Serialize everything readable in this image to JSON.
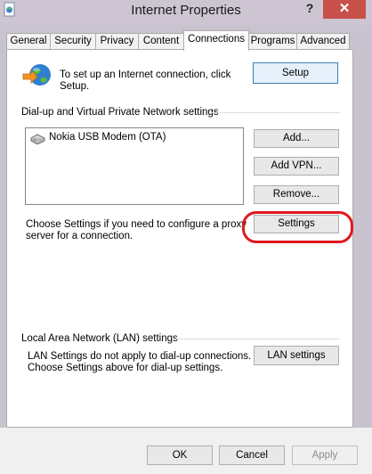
{
  "window": {
    "title": "Internet Properties",
    "help_label": "?",
    "close_label": "✕"
  },
  "tabs": [
    {
      "label": "General"
    },
    {
      "label": "Security"
    },
    {
      "label": "Privacy"
    },
    {
      "label": "Content"
    },
    {
      "label": "Connections"
    },
    {
      "label": "Programs"
    },
    {
      "label": "Advanced"
    }
  ],
  "active_tab": "Connections",
  "setup": {
    "description_line1": "To set up an Internet connection, click",
    "description_line2": "Setup.",
    "button_label": "Setup"
  },
  "dialup": {
    "section_title": "Dial-up and Virtual Private Network settings",
    "connections": [
      {
        "label": "Nokia  USB Modem (OTA)"
      }
    ],
    "add_label": "Add...",
    "add_vpn_label": "Add VPN...",
    "remove_label": "Remove...",
    "settings_hint_line1": "Choose Settings if you need to configure a proxy",
    "settings_hint_line2": "server for a connection.",
    "settings_label": "Settings"
  },
  "lan": {
    "section_title": "Local Area Network (LAN) settings",
    "hint_line1": "LAN Settings do not apply to dial-up connections.",
    "hint_line2": "Choose Settings above for dial-up settings.",
    "button_label": "LAN settings"
  },
  "footer": {
    "ok_label": "OK",
    "cancel_label": "Cancel",
    "apply_label": "Apply"
  },
  "colors": {
    "close_button": "#c7504a",
    "highlight_annotation": "#e0181c",
    "focus_border": "#3c7fb1"
  }
}
